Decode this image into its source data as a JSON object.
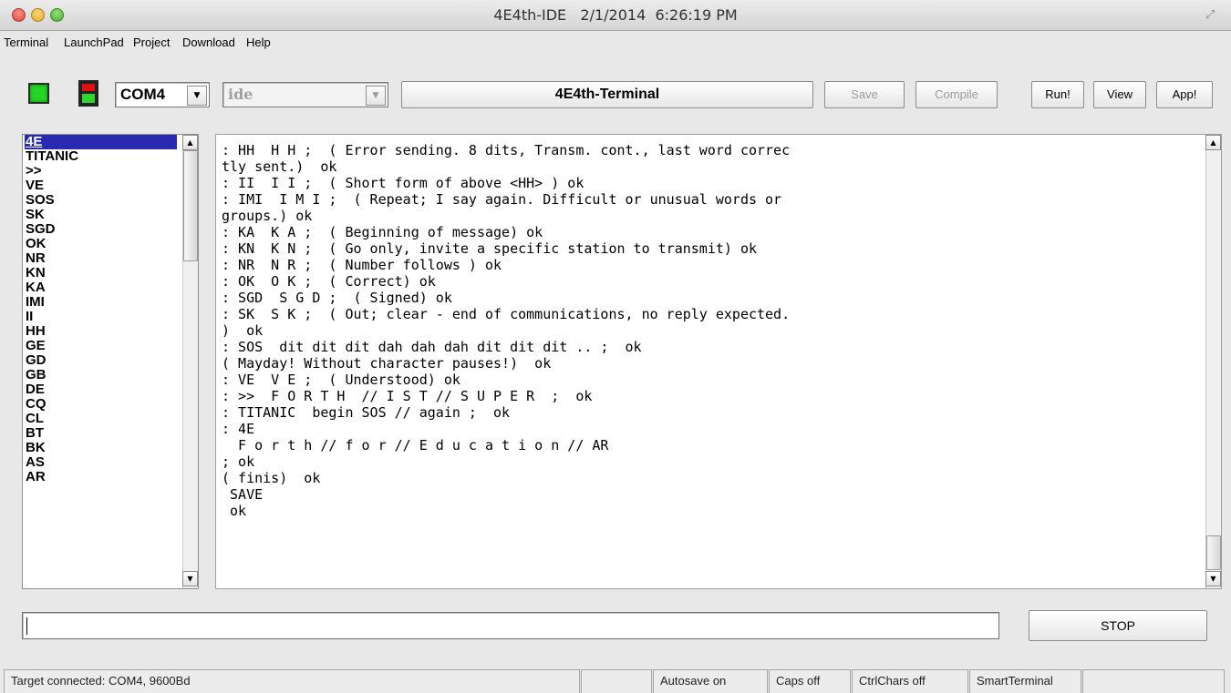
{
  "window": {
    "title": "4E4th-IDE   2/1/2014  6:26:19 PM"
  },
  "menu": [
    "Terminal",
    "LaunchPad",
    "Project",
    "Download",
    "Help"
  ],
  "toolbar": {
    "port": "COM4",
    "mode": "ide",
    "terminal_label": "4E4th-Terminal",
    "save_label": "Save",
    "compile_label": "Compile",
    "run_label": "Run!",
    "view_label": "View",
    "app_label": "App!"
  },
  "words": [
    "4E",
    "TITANIC",
    ">>",
    "VE",
    "SOS",
    "SK",
    "SGD",
    "OK",
    "NR",
    "KN",
    "KA",
    "IMI",
    "II",
    "HH",
    "GE",
    "GD",
    "GB",
    "DE",
    "CQ",
    "CL",
    "BT",
    "BK",
    "AS",
    "AR"
  ],
  "terminal_lines": [
    ": HH  H H ;  ( Error sending. 8 dits, Transm. cont., last word correc",
    "tly sent.)  ok",
    ": II  I I ;  ( Short form of above <HH> ) ok",
    ": IMI  I M I ;  ( Repeat; I say again. Difficult or unusual words or",
    "groups.) ok",
    ": KA  K A ;  ( Beginning of message) ok",
    ": KN  K N ;  ( Go only, invite a specific station to transmit) ok",
    ": NR  N R ;  ( Number follows ) ok",
    ": OK  O K ;  ( Correct) ok",
    ": SGD  S G D ;  ( Signed) ok",
    ": SK  S K ;  ( Out; clear - end of communications, no reply expected.",
    ")  ok",
    ": SOS  dit dit dit dah dah dah dit dit dit .. ;  ok",
    "( Mayday! Without character pauses!)  ok",
    ": VE  V E ;  ( Understood) ok",
    ": >>  F O R T H  // I S T // S U P E R  ;  ok",
    ": TITANIC  begin SOS // again ;  ok",
    ": 4E",
    "  F o r t h // f o r // E d u c a t i o n // AR",
    "; ok",
    "( finis)  ok",
    " SAVE",
    " ok"
  ],
  "command": {
    "value": "",
    "stop_label": "STOP"
  },
  "status": {
    "connection": "Target connected: COM4, 9600Bd",
    "empty": "",
    "autosave": "Autosave on",
    "caps": "Caps off",
    "ctrlchars": "CtrlChars off",
    "mode": "SmartTerminal",
    "extra": ""
  },
  "colors": {
    "selection": "#2a2ab0",
    "led_green": "#26d626",
    "led_red": "#e01010"
  }
}
